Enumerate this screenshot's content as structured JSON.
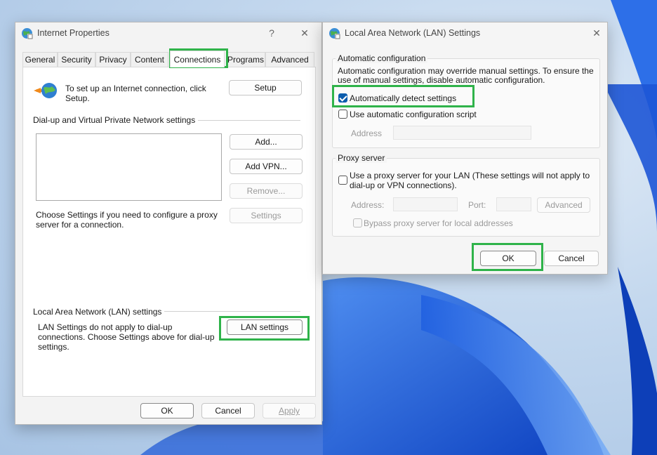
{
  "internet_properties": {
    "title": "Internet Properties",
    "help_glyph": "?",
    "close_glyph": "✕",
    "tabs": [
      "General",
      "Security",
      "Privacy",
      "Content",
      "Connections",
      "Programs",
      "Advanced"
    ],
    "active_tab": "Connections",
    "setup_text": "To set up an Internet connection, click Setup.",
    "setup_button": "Setup",
    "dialup_group_label": "Dial-up and Virtual Private Network settings",
    "add_button": "Add...",
    "add_vpn_button": "Add VPN...",
    "remove_button": "Remove...",
    "settings_button": "Settings",
    "proxy_hint": "Choose Settings if you need to configure a proxy server for a connection.",
    "lan_group_label": "Local Area Network (LAN) settings",
    "lan_hint": "LAN Settings do not apply to dial-up connections. Choose Settings above for dial-up settings.",
    "lan_settings_button": "LAN settings",
    "ok_button": "OK",
    "cancel_button": "Cancel",
    "apply_button": "Apply"
  },
  "lan_settings": {
    "title": "Local Area Network (LAN) Settings",
    "close_glyph": "✕",
    "auto_config_group": "Automatic configuration",
    "auto_config_desc": "Automatic configuration may override manual settings.  To ensure the use of manual settings, disable automatic configuration.",
    "auto_detect_label": "Automatically detect settings",
    "auto_detect_checked": true,
    "auto_script_label": "Use automatic configuration script",
    "auto_script_checked": false,
    "address_label": "Address",
    "proxy_group": "Proxy server",
    "use_proxy_label": "Use a proxy server for your LAN (These settings will not apply to dial-up or VPN connections).",
    "use_proxy_checked": false,
    "proxy_address_label": "Address:",
    "port_label": "Port:",
    "advanced_button": "Advanced",
    "bypass_label": "Bypass proxy server for local addresses",
    "bypass_checked": false,
    "ok_button": "OK",
    "cancel_button": "Cancel"
  },
  "colors": {
    "highlight": "#2fb34a",
    "checkbox_accent": "#0b5cad"
  }
}
